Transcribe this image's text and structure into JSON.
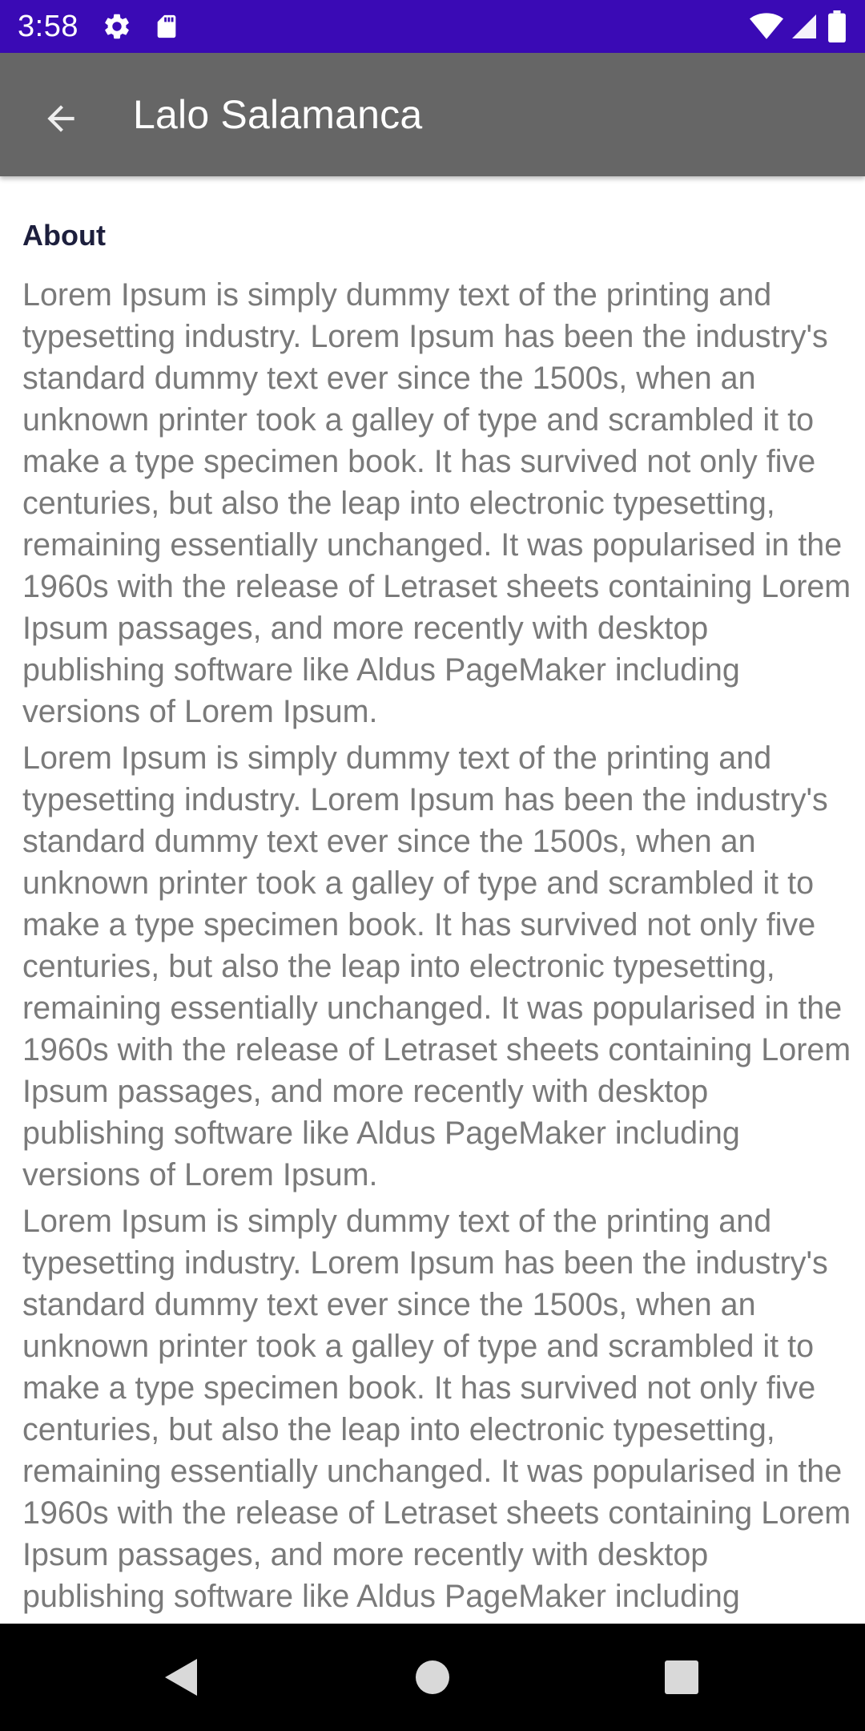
{
  "status_bar": {
    "time": "3:58",
    "icons": [
      "settings-icon",
      "sd-card-icon",
      "wifi-icon",
      "signal-icon",
      "battery-icon"
    ],
    "background": "#3a0ab5"
  },
  "app_bar": {
    "title": "Lalo Salamanca",
    "back_icon": "arrow-back-icon",
    "background": "#666666"
  },
  "content": {
    "heading": "About",
    "paragraphs": [
      "Lorem Ipsum is simply dummy text of the printing and typesetting industry. Lorem Ipsum has been the industry's standard dummy text ever since the 1500s, when an unknown printer took a galley of type and scrambled it to make a type specimen book. It has survived not only five centuries, but also the leap into electronic typesetting, remaining essentially unchanged. It was popularised in the 1960s with the release of Letraset sheets containing Lorem Ipsum passages, and more recently with desktop publishing software like Aldus PageMaker including versions of Lorem Ipsum.",
      "Lorem Ipsum is simply dummy text of the printing and typesetting industry. Lorem Ipsum has been the industry's standard dummy text ever since the 1500s, when an unknown printer took a galley of type and scrambled it to make a type specimen book. It has survived not only five centuries, but also the leap into electronic typesetting, remaining essentially unchanged. It was popularised in the 1960s with the release of Letraset sheets containing Lorem Ipsum passages, and more recently with desktop publishing software like Aldus PageMaker including versions of Lorem Ipsum.",
      "Lorem Ipsum is simply dummy text of the printing and typesetting industry. Lorem Ipsum has been the industry's standard dummy text ever since the 1500s, when an unknown printer took a galley of type and scrambled it to make a type specimen book. It has survived not only five centuries, but also the leap into electronic typesetting, remaining essentially unchanged. It was popularised in the 1960s with the release of Letraset sheets containing Lorem Ipsum passages, and more recently with desktop publishing software like Aldus PageMaker including versions of Lorem Ipsum."
    ]
  },
  "nav_bar": {
    "buttons": [
      "back-triangle-icon",
      "home-circle-icon",
      "recents-square-icon"
    ]
  }
}
